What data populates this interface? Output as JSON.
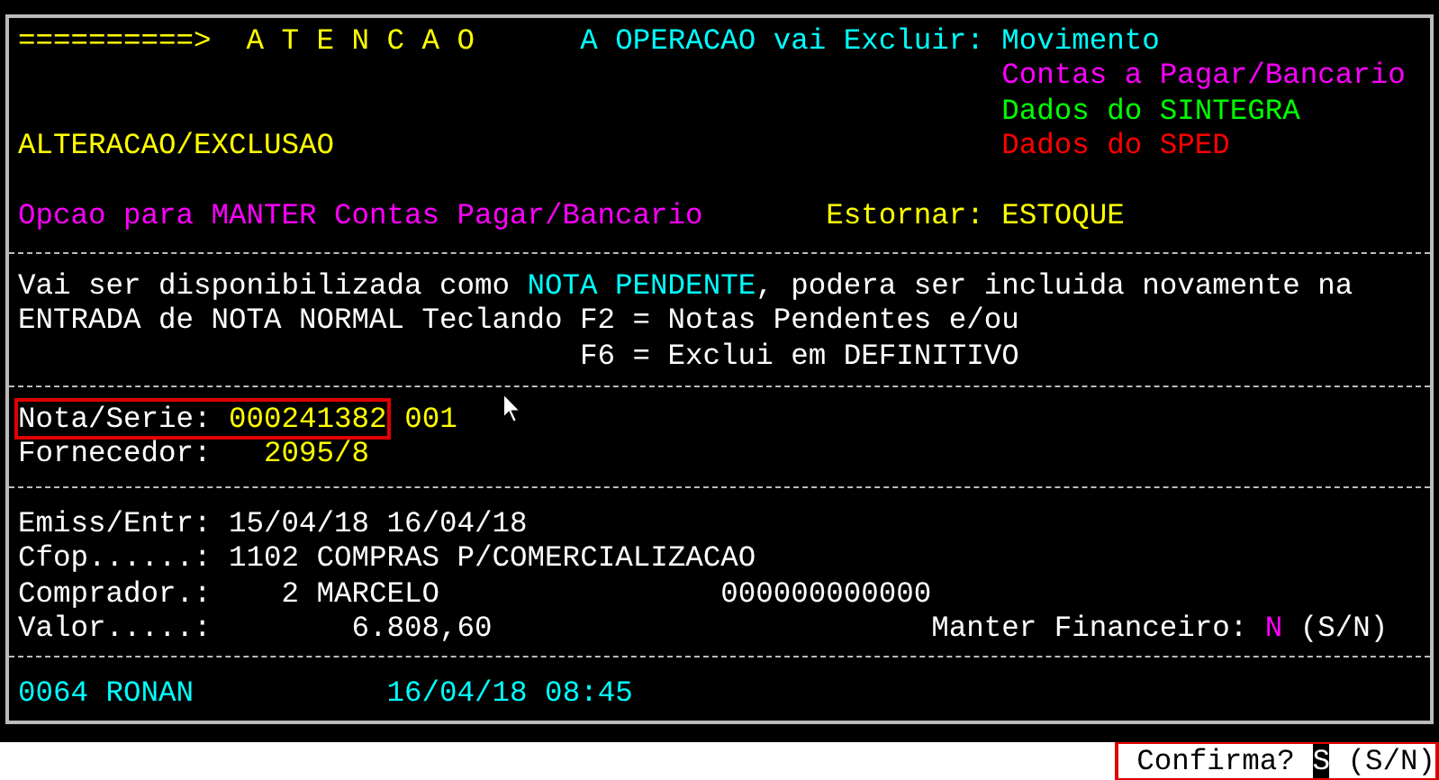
{
  "alert": {
    "arrow": "==========>",
    "title": "A T E N C A O",
    "operation_label": "A OPERACAO vai Excluir:",
    "targets": [
      {
        "text": "Movimento",
        "color": "#00ffff"
      },
      {
        "text": "Contas a Pagar/Bancario",
        "color": "#ff00ff"
      },
      {
        "text": "Dados do SINTEGRA",
        "color": "#00ff00"
      },
      {
        "text": "Dados do SPED",
        "color": "#ff0000"
      }
    ],
    "mode": "ALTERACAO/EXCLUSAO",
    "option": "Opcao para MANTER Contas Pagar/Bancario",
    "reverse_label": "Estornar:",
    "reverse_value": "ESTOQUE"
  },
  "message": {
    "lines": [
      [
        {
          "text": "Vai ser disponibilizada como ",
          "highlight": false
        },
        {
          "text": "NOTA PENDENTE",
          "highlight": true
        },
        {
          "text": ", podera ser incluida novamente na",
          "highlight": false
        }
      ],
      [
        {
          "text": "ENTRADA de NOTA NORMAL Teclando F2 = Notas Pendentes e/ou",
          "highlight": false
        }
      ],
      [
        {
          "text": "F6 = Exclui em DEFINITIVO",
          "highlight": false
        }
      ]
    ]
  },
  "document": {
    "nota_label": "Nota/Serie:",
    "nota_value": "000241382",
    "serie": "001",
    "nota_highlighted": true,
    "fornecedor_label": "Fornecedor:",
    "fornecedor_value": "2095/8"
  },
  "details": {
    "emiss_label": "Emiss/Entr:",
    "emiss_value": "15/04/18 16/04/18",
    "cfop_label": "Cfop......:",
    "cfop_value": "1102 COMPRAS P/COMERCIALIZACAO",
    "comprador_label": "Comprador.:",
    "comprador_value": "2 MARCELO",
    "comprador_code": "000000000000",
    "valor_label": "Valor.....:",
    "valor_value": "6.808,60",
    "financeiro_label": "Manter Financeiro:",
    "financeiro_value": "N",
    "financeiro_options": "(S/N)"
  },
  "footer": {
    "user": "0064 RONAN",
    "datetime": "16/04/18 08:45"
  },
  "prompt": {
    "label": "Confirma?",
    "value": "S",
    "options": "(S/N)",
    "highlighted": true
  }
}
